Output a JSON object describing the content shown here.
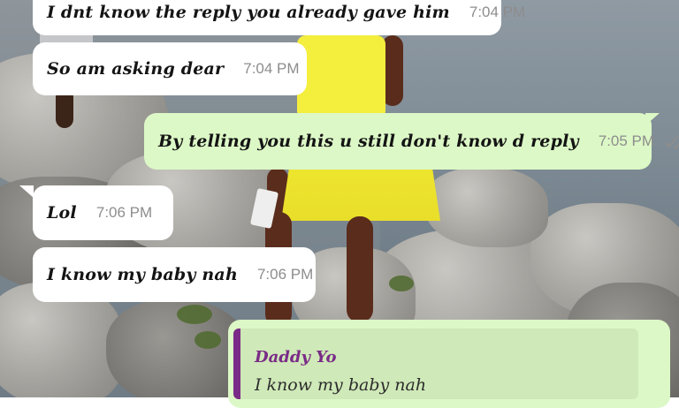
{
  "colors": {
    "incoming_bubble": "#ffffff",
    "outgoing_bubble": "#dcf8c6",
    "quote_accent": "#7a2b87",
    "time_text": "#8d8d8d"
  },
  "messages": [
    {
      "direction": "incoming",
      "text": "I dnt know the reply you already gave him",
      "time": "7:04 PM"
    },
    {
      "direction": "incoming",
      "text": "So am asking dear",
      "time": "7:04 PM"
    },
    {
      "direction": "outgoing",
      "text": "By telling you this u still don't know d reply",
      "time": "7:05 PM",
      "status_icon": "double-check-icon"
    },
    {
      "direction": "incoming",
      "text": "Lol",
      "time": "7:06 PM"
    },
    {
      "direction": "incoming",
      "text": "I know my baby nah",
      "time": "7:06 PM"
    }
  ],
  "reply_preview": {
    "author": "Daddy Yo",
    "quoted_text": "I know my baby nah"
  }
}
